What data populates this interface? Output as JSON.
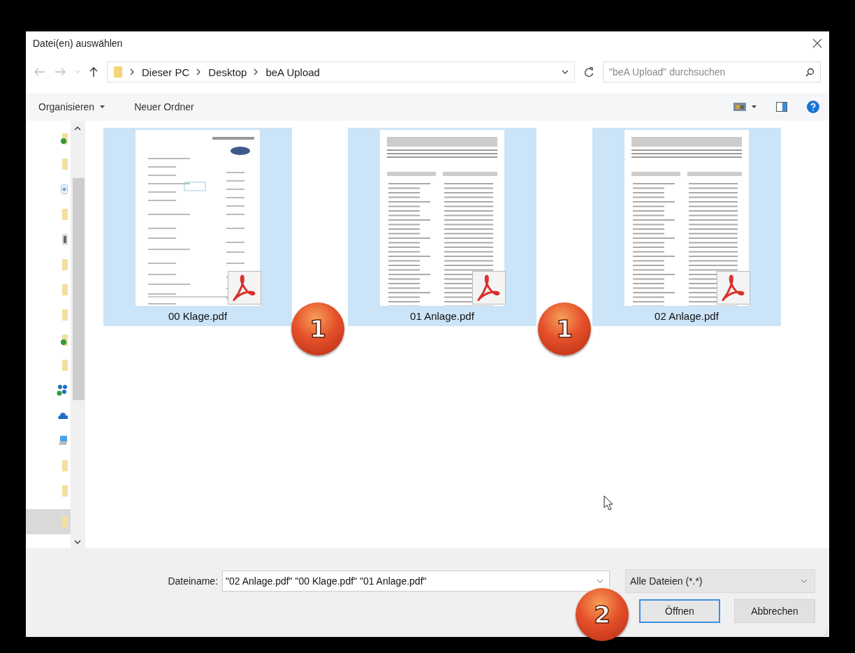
{
  "window": {
    "title": "Datei(en) auswählen"
  },
  "address_bar": {
    "path": [
      "Dieser PC",
      "Desktop",
      "beA Upload"
    ]
  },
  "search": {
    "placeholder": "\"beA Upload\" durchsuchen"
  },
  "toolbar": {
    "buttons": [
      {
        "label": "Organisieren",
        "dropdown": true
      },
      {
        "label": "Neuer Ordner",
        "dropdown": false
      }
    ]
  },
  "sidebar": {
    "items": [
      {
        "kind": "synced-folder",
        "selected": false
      },
      {
        "kind": "folder",
        "selected": false
      },
      {
        "kind": "disc",
        "selected": false
      },
      {
        "kind": "folder",
        "selected": false
      },
      {
        "kind": "picture",
        "selected": false
      },
      {
        "kind": "folder",
        "selected": false
      },
      {
        "kind": "folder",
        "selected": false
      },
      {
        "kind": "folder",
        "selected": false
      },
      {
        "kind": "synced-folder",
        "selected": false
      },
      {
        "kind": "folder",
        "selected": false
      },
      {
        "kind": "people",
        "selected": false
      },
      {
        "kind": "cloud",
        "selected": false
      },
      {
        "kind": "computer",
        "selected": false
      },
      {
        "kind": "folder",
        "selected": false
      },
      {
        "kind": "folder",
        "selected": false
      },
      {
        "kind": "folder",
        "selected": true
      }
    ]
  },
  "files": [
    {
      "name": "00 Klage.pdf",
      "kind": "letter",
      "selected": true
    },
    {
      "name": "01 Anlage.pdf",
      "kind": "form",
      "selected": true
    },
    {
      "name": "02 Anlage.pdf",
      "kind": "form",
      "selected": true
    }
  ],
  "filename": {
    "label": "Dateiname:",
    "value": "\"02 Anlage.pdf\" \"00 Klage.pdf\" \"01 Anlage.pdf\""
  },
  "file_type": {
    "value": "Alle Dateien (*.*)"
  },
  "buttons": [
    {
      "label": "Öffnen",
      "default": true
    },
    {
      "label": "Abbrechen",
      "default": false
    }
  ],
  "callouts": [
    {
      "number": "1"
    },
    {
      "number": "1"
    },
    {
      "number": "2"
    }
  ]
}
